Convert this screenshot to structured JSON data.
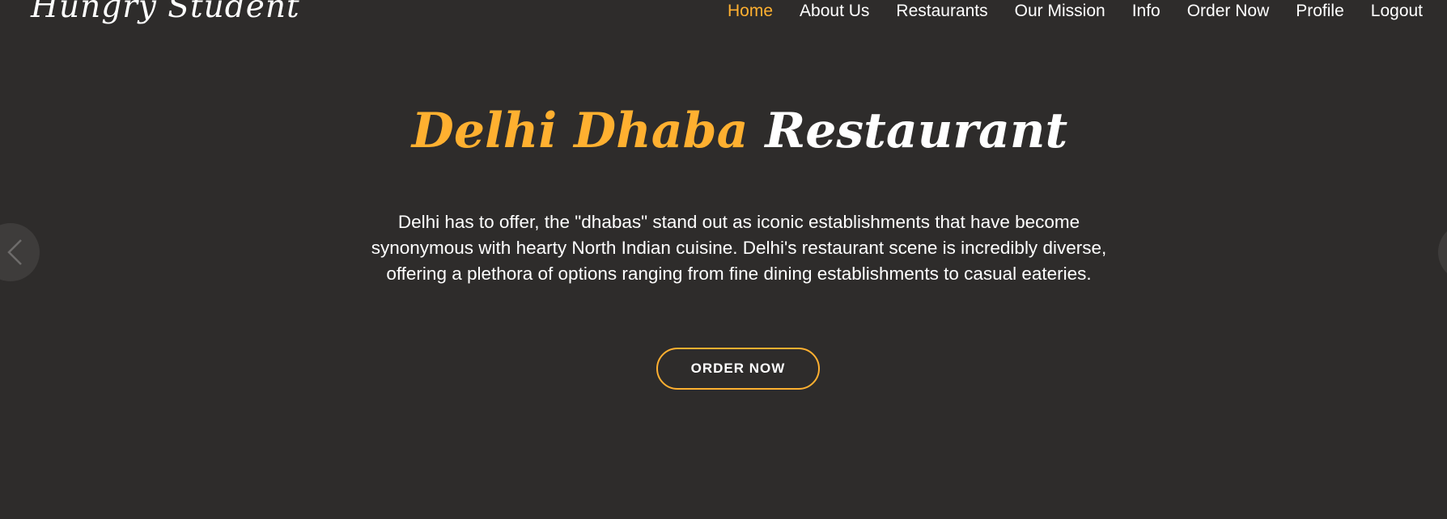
{
  "brand": {
    "logo_text": "Hungry Student"
  },
  "nav": {
    "items": [
      {
        "label": "Home",
        "active": true
      },
      {
        "label": "About Us"
      },
      {
        "label": "Restaurants"
      },
      {
        "label": "Our Mission"
      },
      {
        "label": "Info"
      },
      {
        "label": "Order Now"
      },
      {
        "label": "Profile"
      },
      {
        "label": "Logout"
      }
    ]
  },
  "hero": {
    "title_accent": "Delhi Dhaba",
    "title_rest": " Restaurant",
    "description": "Delhi has to offer, the \"dhabas\" stand out as iconic establishments that have become synonymous with hearty North Indian cuisine. Delhi's restaurant scene is incredibly diverse, offering a plethora of options ranging from fine dining establishments to casual eateries.",
    "cta_label": "ORDER NOW"
  },
  "carousel": {
    "prev_icon": "chevron-left-icon",
    "next_icon": "chevron-right-icon"
  },
  "colors": {
    "background": "#2e2c2b",
    "accent": "#ffb030",
    "text": "#ffffff"
  }
}
